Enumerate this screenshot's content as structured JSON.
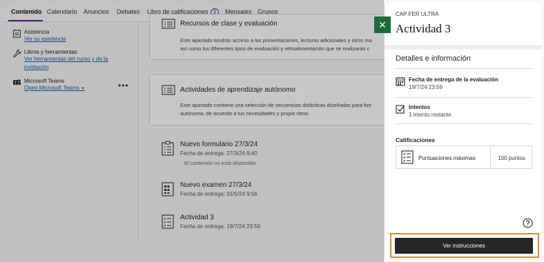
{
  "nav": {
    "tabs": [
      {
        "label": "Contenido"
      },
      {
        "label": "Calendario"
      },
      {
        "label": "Anuncios"
      },
      {
        "label": "Debates"
      },
      {
        "label": "Libro de calificaciones",
        "badge": "3"
      },
      {
        "label": "Mensajes"
      },
      {
        "label": "Grupos"
      }
    ],
    "active_tab": "Contenido"
  },
  "sidebar": {
    "items": [
      {
        "title": "Asistencia",
        "link": "Ver su asistencia",
        "icon": "attendance-icon"
      },
      {
        "title": "Libros y herramientas",
        "link_line1": "Ver herramientas del curso y de la",
        "link_line2": "institución",
        "icon": "wrench-icon"
      },
      {
        "title": "Microsoft Teams",
        "link": "Open Microsoft Teams",
        "icon": "teams-icon"
      }
    ],
    "more_label": "•••"
  },
  "content": {
    "folder1": {
      "title": "Recursos de clase y evaluación",
      "desc1": "Este apartado tendrás acceso a las presentaciones, lecturas adicionales y otros ma",
      "desc2": "así como los diferentes tipos de evaluación y retroalimentación que se realizarán c"
    },
    "folder2": {
      "title": "Actividades de aprendizaje autónomo",
      "desc1": "Este apartado contiene una selección de secuencias didácticas diseñadas para fort",
      "desc2": "autónoma, de acuerdo a tus necesidades y propio ritmo."
    },
    "items": [
      {
        "title": "Nuevo formulario 27/3/24",
        "due": "Fecha de entrega: 27/3/24 9:40",
        "note": "El contenido no está disponible"
      },
      {
        "title": "Nuevo examen 27/3/24",
        "due": "Fecha de entrega: 31/5/24 9:56"
      },
      {
        "title": "Actividad 3",
        "due": "Fecha de entrega: 19/7/24 23:59"
      }
    ]
  },
  "panel": {
    "course": "CAP FER ULTRA",
    "title": "Actividad 3",
    "section_title": "Detalles e información",
    "due_label": "Fecha de entrega de la evaluación",
    "due_value": "19/7/24 23:59",
    "attempts_label": "Intentos",
    "attempts_value": "1 intento restante",
    "grades_title": "Calificaciones",
    "max_score_label": "Puntuaciones máximas",
    "max_score_value": "100 puntos",
    "primary_button": "Ver instrucciones",
    "close_glyph": "✕"
  },
  "colors": {
    "accent": "#5b2a86",
    "close_button": "#1e6b3a",
    "primary_button": "#262626",
    "highlight": "#e0873a"
  }
}
